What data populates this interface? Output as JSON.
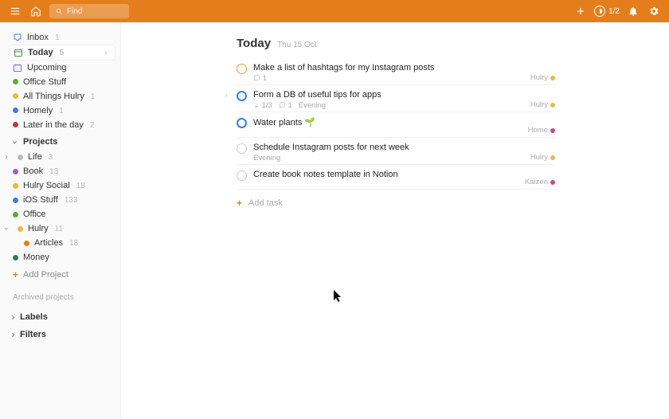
{
  "topbar": {
    "search_placeholder": "Find",
    "progress": "1/2"
  },
  "sidebar": {
    "nav": [
      {
        "label": "Inbox",
        "count": "1",
        "icon": "inbox",
        "color": "#3b82d6"
      },
      {
        "label": "Today",
        "count": "5",
        "icon": "today",
        "color": "#4c8f3a",
        "active": true
      },
      {
        "label": "Upcoming",
        "count": "",
        "icon": "upcoming",
        "color": "#8a63d2"
      },
      {
        "label": "Office Stuff",
        "count": "",
        "icon": "dot",
        "color": "#5fa938"
      },
      {
        "label": "All Things Hulry",
        "count": "1",
        "icon": "dot",
        "color": "#e6bc3e"
      },
      {
        "label": "Homely",
        "count": "1",
        "icon": "dot",
        "color": "#3a7de0"
      },
      {
        "label": "Later in the day",
        "count": "2",
        "icon": "dot",
        "color": "#b53a3a"
      }
    ],
    "projects_label": "Projects",
    "projects": [
      {
        "label": "Life",
        "count": "3",
        "color": "#b9b9b9",
        "expandable": true
      },
      {
        "label": "Book",
        "count": "13",
        "color": "#9a5ed2"
      },
      {
        "label": "Hulry Social",
        "count": "18",
        "color": "#e6bc3e"
      },
      {
        "label": "iOS Stuff",
        "count": "133",
        "color": "#3a7de0"
      },
      {
        "label": "Office",
        "count": "",
        "color": "#5fa938"
      },
      {
        "label": "Hulry",
        "count": "11",
        "color": "#e6bc3e",
        "expanded": true,
        "children": [
          {
            "label": "Articles",
            "count": "18",
            "color": "#e47e1a"
          }
        ]
      },
      {
        "label": "Money",
        "count": "",
        "color": "#2e7d4a"
      }
    ],
    "add_project": "Add Project",
    "archived": "Archived projects",
    "labels": "Labels",
    "filters": "Filters"
  },
  "page": {
    "title": "Today",
    "date": "Thu 15 Oct"
  },
  "tasks": [
    {
      "title": "Make a list of hashtags for my Instagram posts",
      "check_style": "orange",
      "comments": "1",
      "tag": "Hulry",
      "tag_color": "#e6bc3e"
    },
    {
      "title": "Form a DB of useful tips for apps",
      "check_style": "blue",
      "subtasks": "1/3",
      "comments": "1",
      "time": "Evening",
      "expandable": true,
      "tag": "Hulry",
      "tag_color": "#e6bc3e"
    },
    {
      "title": "Water plants 🌱",
      "check_style": "blue",
      "tag": "Home",
      "tag_color": "#c24a8a"
    },
    {
      "title": "Schedule Instagram posts for next week",
      "check_style": "gray",
      "time": "Evening",
      "tag": "Hulry",
      "tag_color": "#e6bc3e"
    },
    {
      "title": "Create book notes template in Notion",
      "check_style": "gray",
      "tag": "Kaizen",
      "tag_color": "#c24a8a"
    }
  ],
  "add_task": "Add task"
}
